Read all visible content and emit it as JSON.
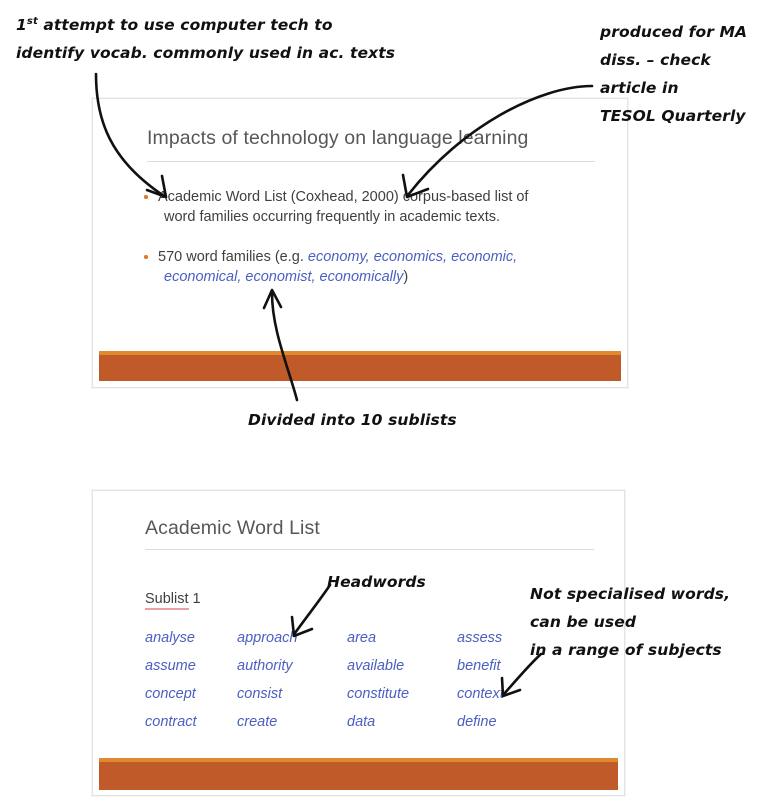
{
  "slide_one": {
    "title": "Impacts of technology on language learning",
    "bullets": [
      {
        "line1": "Academic Word List (Coxhead,  2000) corpus-based list of",
        "line2": "word families occurring  frequently in academic texts."
      },
      {
        "line1_prefix": "570 word families (e.g. ",
        "line1_italic": "economy, economics, economic,",
        "line2_italic": "economical, economist, economically",
        "line2_suffix": ")"
      }
    ],
    "accent_color": "#c05a28",
    "accent_top_color": "#e08a30",
    "bullet_dot_color": "#dd7a2a"
  },
  "slide_two": {
    "title": "Academic Word List",
    "sublist_label_word": "Sublist",
    "sublist_label_number": " 1",
    "word_color": "#4a5fc1",
    "words": [
      "analyse",
      "approach",
      "area",
      "assess",
      "assume",
      "authority",
      "available",
      "benefit",
      "concept",
      "consist",
      "constitute",
      "context",
      "contract",
      "create",
      "data",
      "define"
    ]
  },
  "annotations": {
    "top_left": {
      "line1_pre": "1",
      "line1_sup": "st",
      "line1_post": " attempt to use computer tech to",
      "line2": "identify vocab. commonly used in ac. texts"
    },
    "top_right": {
      "line1": "produced for MA",
      "line2": "diss. – check",
      "line3": "article in",
      "line4": "TESOL Quarterly"
    },
    "sublists": "Divided into 10 sublists",
    "headwords": "Headwords",
    "range": {
      "line1": "Not specialised words,",
      "line2": "can be used",
      "line3": "in a range of subjects"
    }
  }
}
